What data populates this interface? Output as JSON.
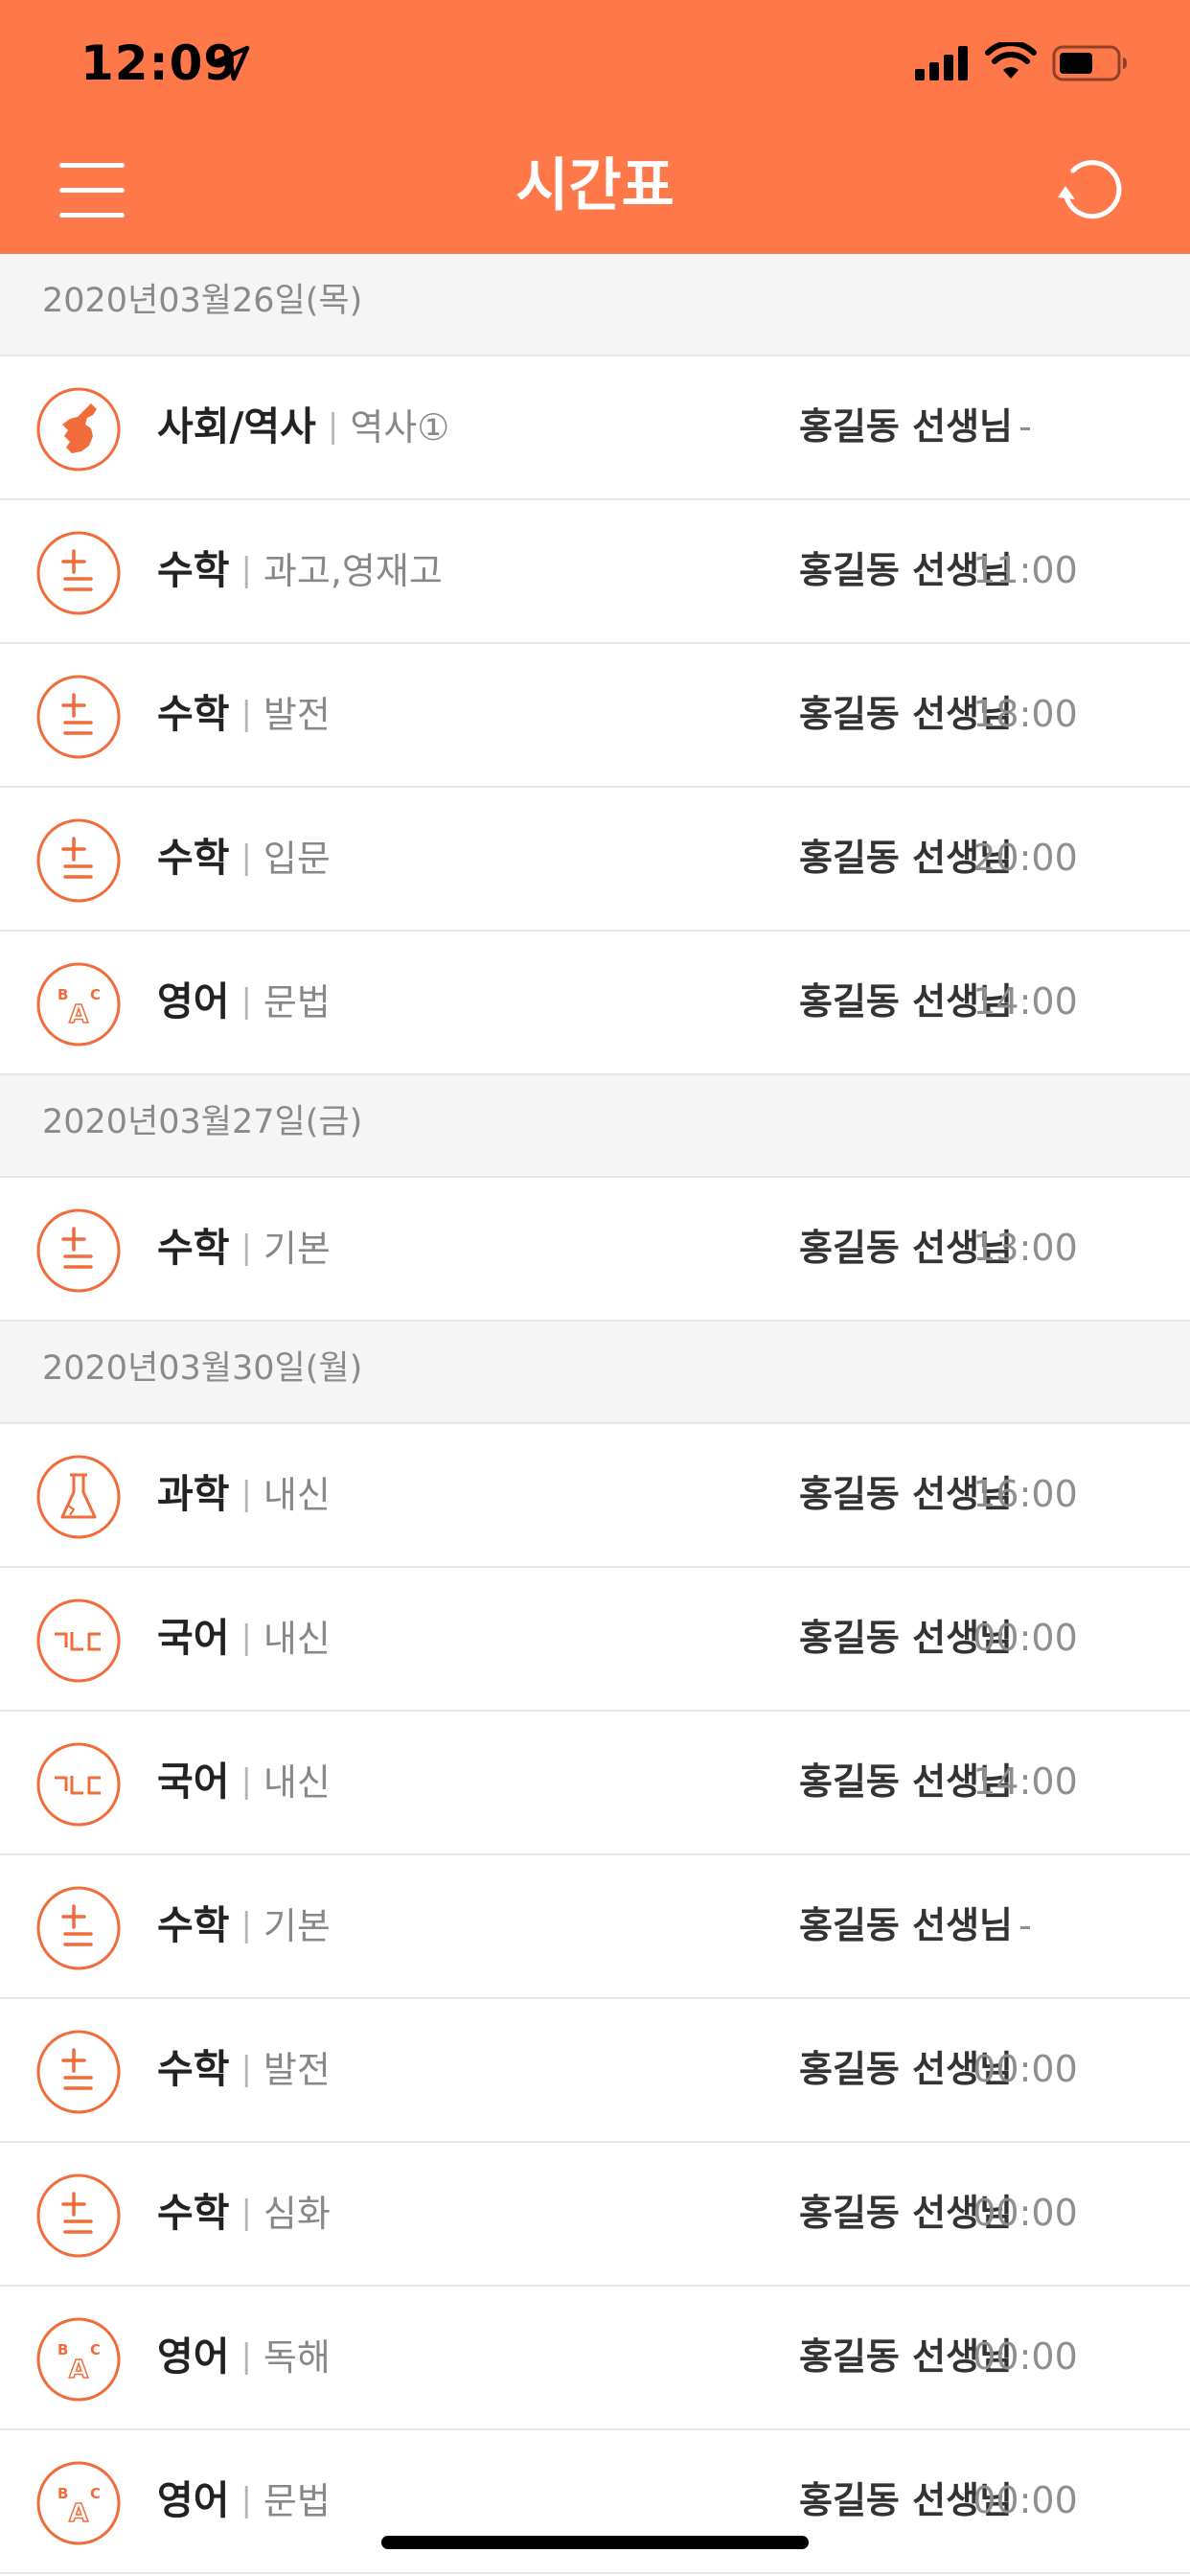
{
  "status_bar": {
    "time": "12:09"
  },
  "nav": {
    "title": "시간표",
    "menu_icon": "hamburger-menu-icon",
    "refresh_icon": "refresh-icon"
  },
  "colors": {
    "header": "#FF7849",
    "accent": "#F26B3A"
  },
  "sections": [
    {
      "date": "2020년03월26일(목)",
      "rows": [
        {
          "subject": "사회/역사",
          "class": "역사①",
          "teacher": "홍길동 선생님",
          "time": "-",
          "icon": "korea-map-icon"
        },
        {
          "subject": "수학",
          "class": "과고,영재고",
          "teacher": "홍길동 선생님",
          "time": "11:00",
          "icon": "math-plus-minus-icon"
        },
        {
          "subject": "수학",
          "class": "발전",
          "teacher": "홍길동 선생님",
          "time": "18:00",
          "icon": "math-plus-minus-icon"
        },
        {
          "subject": "수학",
          "class": "입문",
          "teacher": "홍길동 선생님",
          "time": "20:00",
          "icon": "math-plus-minus-icon"
        },
        {
          "subject": "영어",
          "class": "문법",
          "teacher": "홍길동 선생님",
          "time": "14:00",
          "icon": "english-abc-icon"
        }
      ]
    },
    {
      "date": "2020년03월27일(금)",
      "rows": [
        {
          "subject": "수학",
          "class": "기본",
          "teacher": "홍길동 선생님",
          "time": "13:00",
          "icon": "math-plus-minus-icon"
        }
      ]
    },
    {
      "date": "2020년03월30일(월)",
      "rows": [
        {
          "subject": "과학",
          "class": "내신",
          "teacher": "홍길동 선생님",
          "time": "16:00",
          "icon": "science-flask-icon"
        },
        {
          "subject": "국어",
          "class": "내신",
          "teacher": "홍길동 선생님",
          "time": "00:00",
          "icon": "korean-letters-icon"
        },
        {
          "subject": "국어",
          "class": "내신",
          "teacher": "홍길동 선생님",
          "time": "14:00",
          "icon": "korean-letters-icon"
        },
        {
          "subject": "수학",
          "class": "기본",
          "teacher": "홍길동 선생님",
          "time": "-",
          "icon": "math-plus-minus-icon"
        },
        {
          "subject": "수학",
          "class": "발전",
          "teacher": "홍길동 선생님",
          "time": "00:00",
          "icon": "math-plus-minus-icon"
        },
        {
          "subject": "수학",
          "class": "심화",
          "teacher": "홍길동 선생님",
          "time": "00:00",
          "icon": "math-plus-minus-icon"
        },
        {
          "subject": "영어",
          "class": "독해",
          "teacher": "홍길동 선생님",
          "time": "00:00",
          "icon": "english-abc-icon"
        },
        {
          "subject": "영어",
          "class": "문법",
          "teacher": "홍길동 선생님",
          "time": "00:00",
          "icon": "english-abc-icon"
        }
      ]
    }
  ]
}
